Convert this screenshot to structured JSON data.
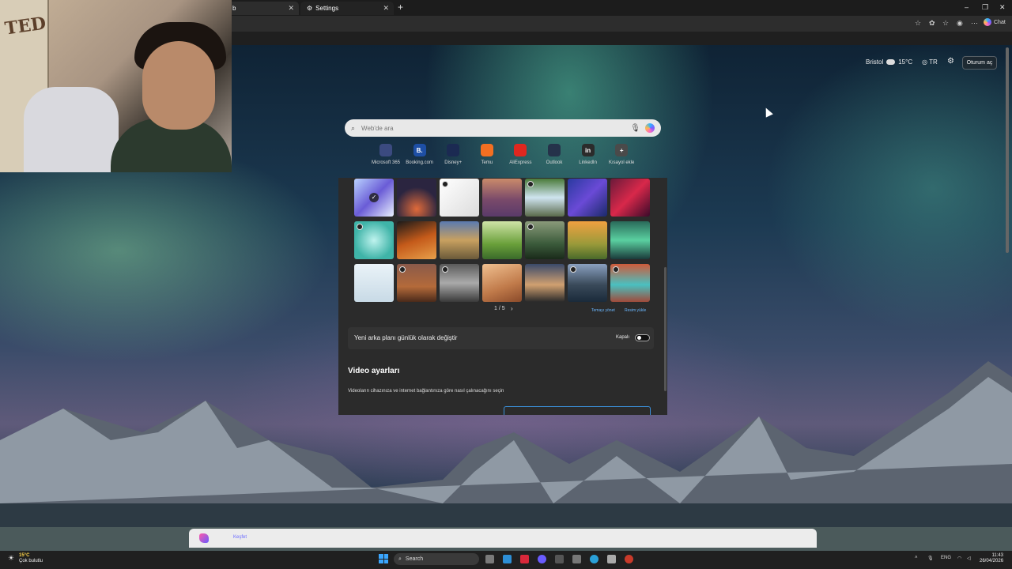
{
  "browser": {
    "tabs": [
      {
        "title": "b",
        "active": true
      },
      {
        "title": "Settings",
        "active": false
      }
    ],
    "new_tab_icon": "plus-icon",
    "toolbar_icons": [
      "star-icon",
      "extension-icon",
      "favorites-icon",
      "profile-icon",
      "more-icon"
    ],
    "copilot_label": "Chat"
  },
  "newtab": {
    "weather": {
      "city": "Bristol",
      "temp": "15°C"
    },
    "language": "TR",
    "signin_label": "Oturum aç",
    "search_placeholder": "Web'de ara",
    "quick_links": [
      {
        "label": "Microsoft 365",
        "glyph": "",
        "color": "#3b4a80"
      },
      {
        "label": "Booking.com",
        "glyph": "B.",
        "color": "#1e4fa5"
      },
      {
        "label": "Disney+",
        "glyph": "",
        "color": "#1b2a52"
      },
      {
        "label": "Temu",
        "glyph": "",
        "color": "#f36f21"
      },
      {
        "label": "AliExpress",
        "glyph": "",
        "color": "#e0271f"
      },
      {
        "label": "Outlook",
        "glyph": "",
        "color": "#25324a"
      },
      {
        "label": "LinkedIn",
        "glyph": "in",
        "color": "#2b2b2b"
      },
      {
        "label": "Kısayol ekle",
        "glyph": "+",
        "color": "#4a4a4a"
      }
    ]
  },
  "settings_panel": {
    "wallpapers": [
      {
        "color": "linear-gradient(135deg,#b9d2ff,#6a5cd6,#e9f1ff)",
        "video": false,
        "selected": true
      },
      {
        "color": "radial-gradient(circle at 50% 80%,#e06a3a,#2b2540 60%)",
        "video": false,
        "selected": false
      },
      {
        "color": "linear-gradient(135deg,#ffffff,#dcdcdc)",
        "video": true,
        "selected": false
      },
      {
        "color": "linear-gradient(180deg,#c98a6a,#7a4a6a 55%,#5a3a6a)",
        "video": false,
        "selected": false
      },
      {
        "color": "linear-gradient(180deg,#4a7a3a,#cfe4f0 50%,#5a6a4a)",
        "video": true,
        "selected": false
      },
      {
        "color": "linear-gradient(135deg,#2a3aa0,#6a4ad6,#1a2a6a)",
        "video": false,
        "selected": false
      },
      {
        "color": "linear-gradient(135deg,#6a1a3a,#d8284a,#3a0a2a)",
        "video": false,
        "selected": false
      },
      {
        "color": "radial-gradient(circle at 50% 50%,#bff3ee,#3fb4a8 70%)",
        "video": true,
        "selected": false
      },
      {
        "color": "linear-gradient(160deg,#1a1a1a,#c45a1a 50%,#e8a04a)",
        "video": false,
        "selected": false
      },
      {
        "color": "linear-gradient(180deg,#5a7ab0,#c8a060 50%,#6a5a3a)",
        "video": false,
        "selected": false
      },
      {
        "color": "linear-gradient(180deg,#cfe3a8,#6aa03a 60%,#3a6a2a)",
        "video": false,
        "selected": false
      },
      {
        "color": "linear-gradient(180deg,#8a9a7a,#3a5a3a 60%,#1a2a1a)",
        "video": true,
        "selected": false
      },
      {
        "color": "linear-gradient(180deg,#f0a040,#9a9a3a 60%,#4a6a2a)",
        "video": false,
        "selected": false
      },
      {
        "color": "linear-gradient(180deg,#2a6a5a,#5ad0a0 50%,#1a3a3a)",
        "video": false,
        "selected": false
      },
      {
        "color": "linear-gradient(180deg,#eaf3f8,#c8dae6)",
        "video": false,
        "selected": false
      },
      {
        "color": "linear-gradient(180deg,#8a5a4a,#b46a3a 60%,#4a2a1a)",
        "video": true,
        "selected": false
      },
      {
        "color": "linear-gradient(180deg,#5a5a5a,#aaaaaa 50%,#3a3a3a)",
        "video": true,
        "selected": false
      },
      {
        "color": "linear-gradient(160deg,#f0c090,#c07a4a 60%,#8a4a2a)",
        "video": false,
        "selected": false
      },
      {
        "color": "linear-gradient(180deg,#3a4a6a,#d0a070 55%,#2a2a2a)",
        "video": false,
        "selected": false
      },
      {
        "color": "linear-gradient(180deg,#8aa0c0,#3a4a5a 55%,#1a2a3a)",
        "video": true,
        "selected": false
      },
      {
        "color": "linear-gradient(180deg,#d05a3a,#4ac0c0 55%,#a04a3a)",
        "video": true,
        "selected": false
      }
    ],
    "pager_text": "1 / 5",
    "manage_themes_link": "Temayı yönet",
    "upload_link": "Resim yükle",
    "daily_row_label": "Yeni arka planı günlük olarak değiştir",
    "daily_state": "Kapalı",
    "video_heading": "Video ayarları",
    "video_desc": "Videoların cihazınıza ve internet bağlantınıza göre nasıl çalınacağını seçin"
  },
  "bottom_bar": {
    "label": "Keşfet"
  },
  "taskbar": {
    "weather_temp": "15°C",
    "weather_desc": "Çok bulutlu",
    "search_label": "Search",
    "lang": "ENG",
    "time": "11:43",
    "date": "26/04/2026"
  }
}
